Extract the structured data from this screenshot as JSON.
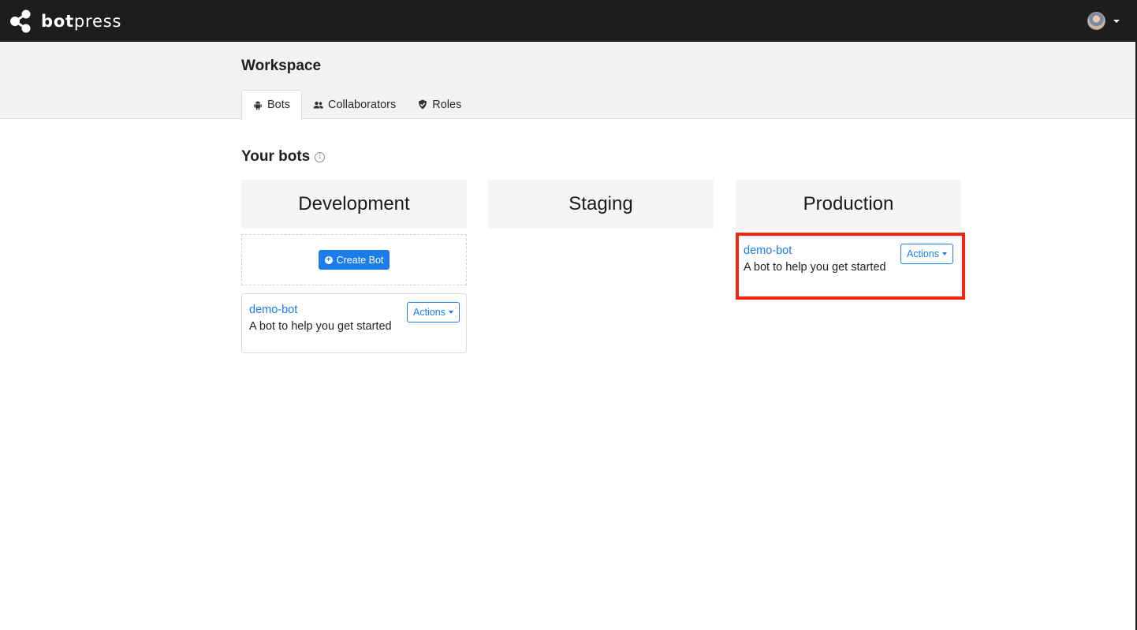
{
  "app": {
    "brand_bold": "bot",
    "brand_light": "press"
  },
  "header": {
    "title": "Workspace",
    "tabs": [
      {
        "label": "Bots",
        "icon": "android-icon",
        "active": true
      },
      {
        "label": "Collaborators",
        "icon": "users-icon",
        "active": false
      },
      {
        "label": "Roles",
        "icon": "shield-icon",
        "active": false
      }
    ]
  },
  "main": {
    "section_title": "Your bots",
    "info_symbol": "i",
    "columns": [
      {
        "title": "Development",
        "create_button": "Create Bot",
        "bots": [
          {
            "name": "demo-bot",
            "description": "A bot to help you get started",
            "actions_label": "Actions"
          }
        ]
      },
      {
        "title": "Staging",
        "bots": []
      },
      {
        "title": "Production",
        "bots": [
          {
            "name": "demo-bot",
            "description": "A bot to help you get started",
            "actions_label": "Actions"
          }
        ]
      }
    ]
  },
  "colors": {
    "topbar": "#1d1d1d",
    "accent": "#1a7de9",
    "highlight": "#f3260f"
  }
}
